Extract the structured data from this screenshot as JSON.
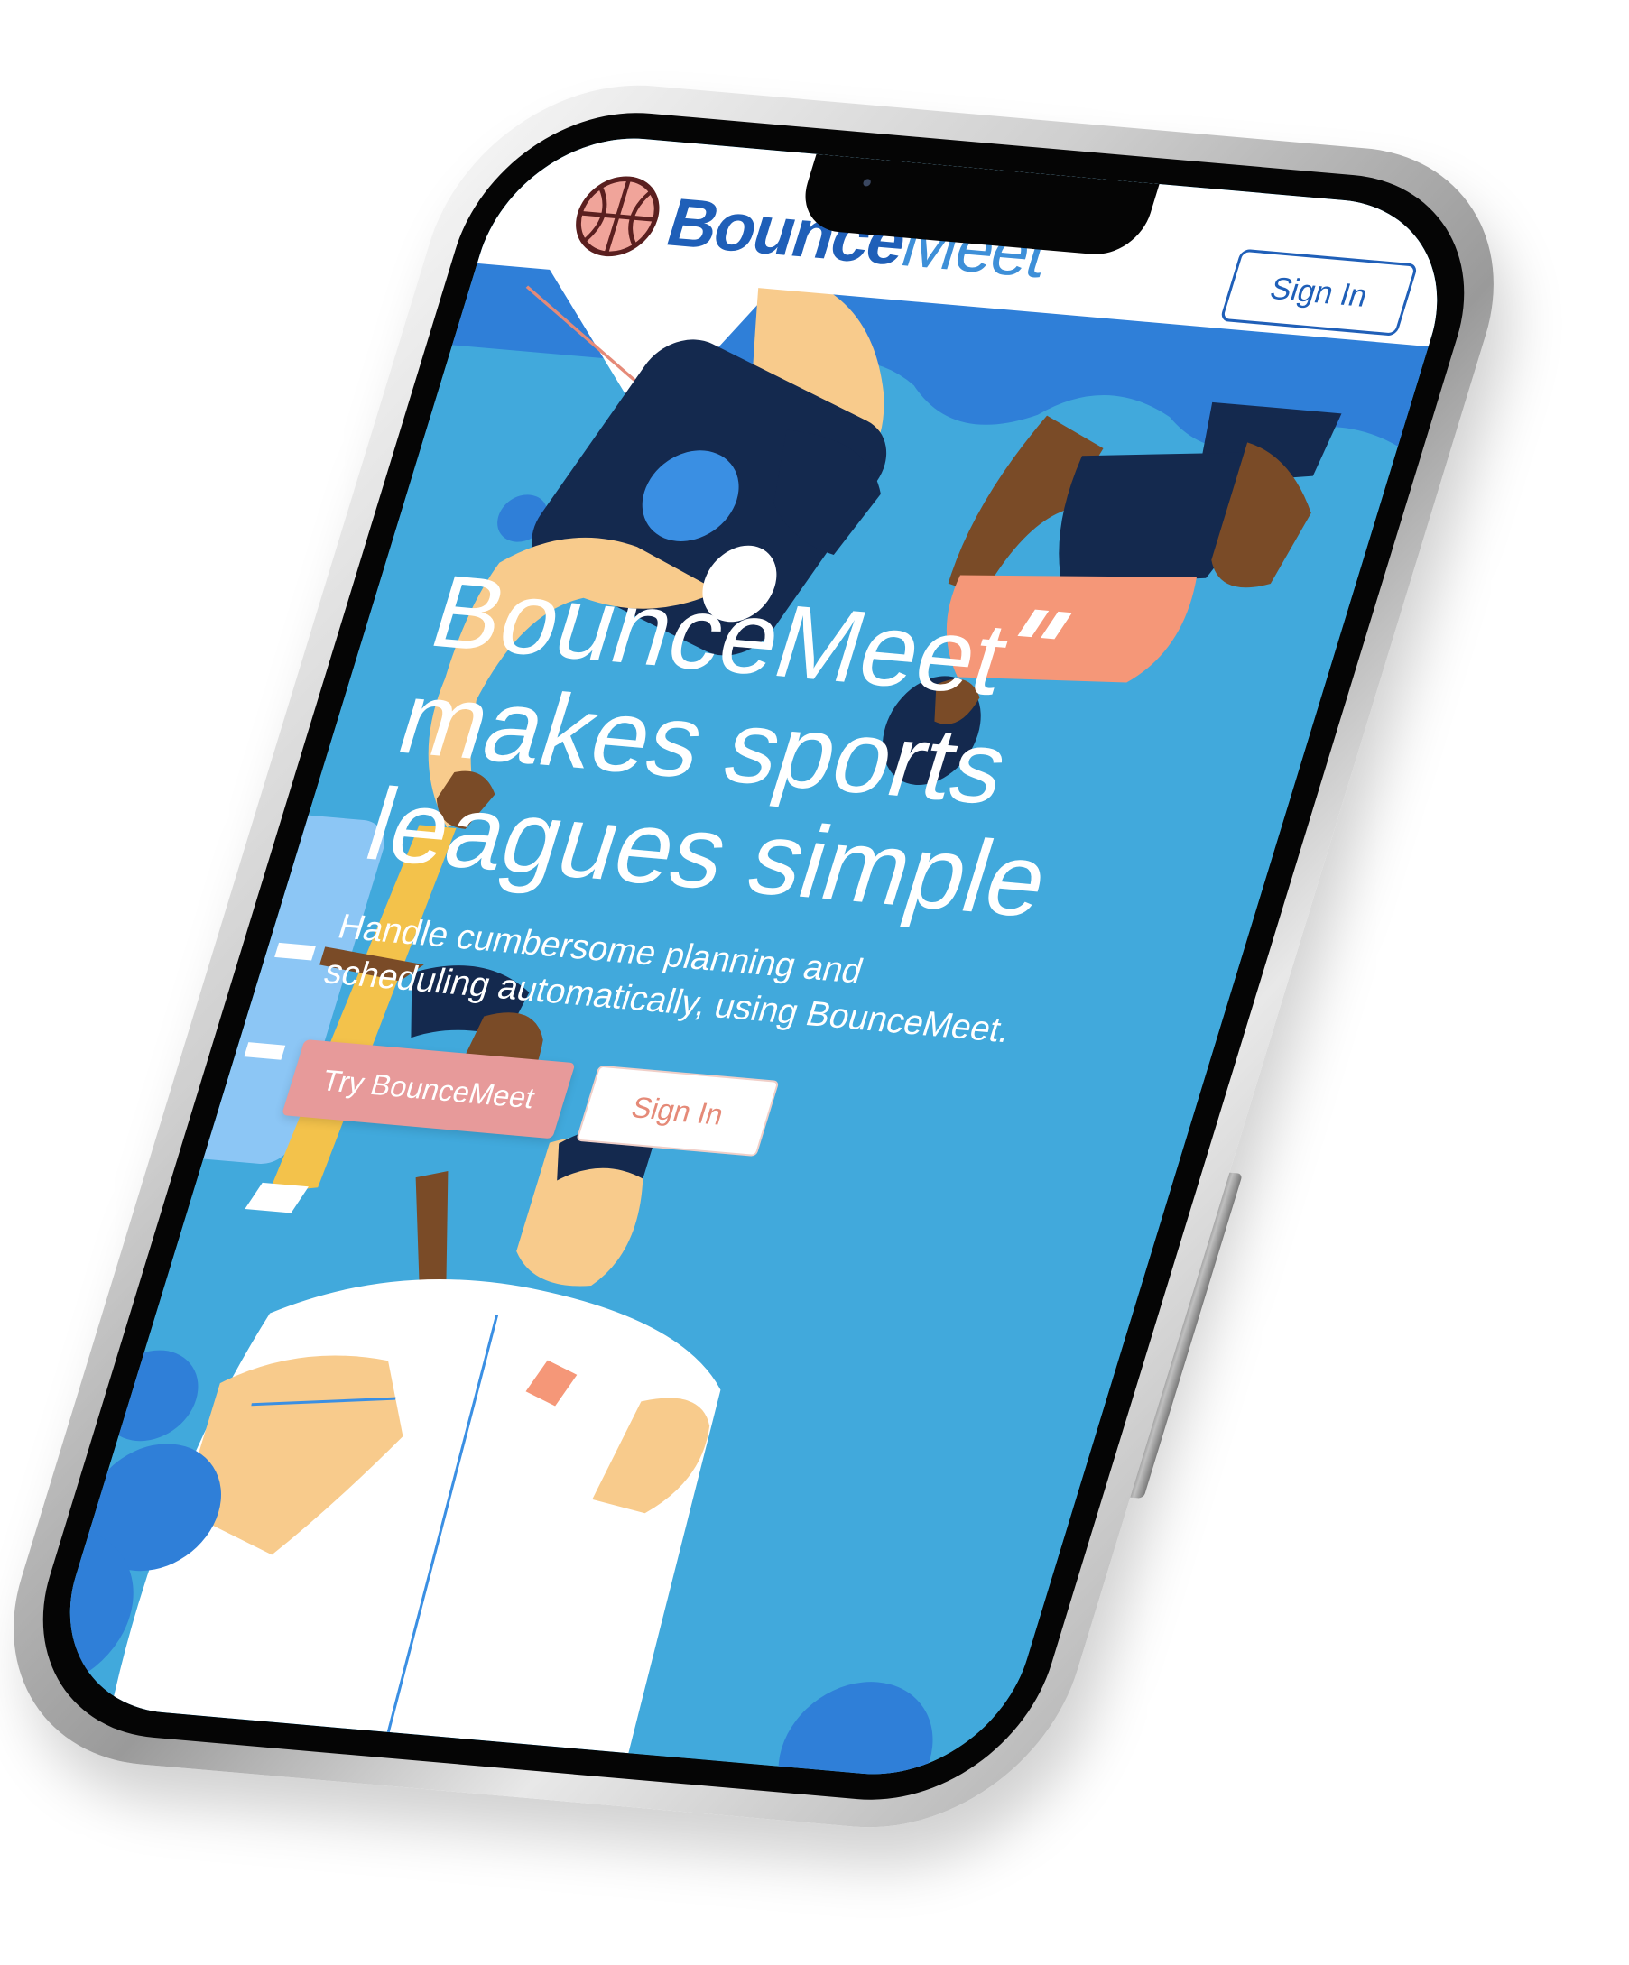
{
  "header": {
    "logo_bold": "Bounce",
    "logo_light": "Meet",
    "signin_label": "Sign In"
  },
  "hero": {
    "title_line1": "BounceMeet",
    "title_line2": "makes sports",
    "title_line3": "leagues simple",
    "subtitle": "Handle cumbersome planning and scheduling automatically, using BounceMeet.",
    "try_label": "Try BounceMeet",
    "signin_label": "Sign In"
  },
  "colors": {
    "brand_blue": "#1f5fb8",
    "hero_bg": "#41a9dc",
    "accent_pink": "#e79a9a",
    "accent_coral": "#e58a78",
    "navy": "#14294e",
    "skin": "#f8cb8c"
  },
  "icons": {
    "logo": "basketball-icon",
    "camera": "front-camera-icon"
  }
}
